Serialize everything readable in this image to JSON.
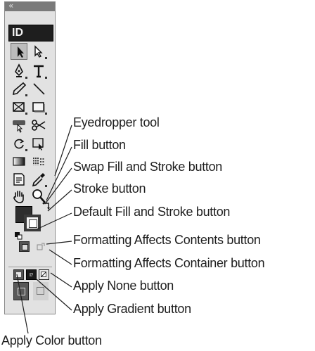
{
  "toolbox": {
    "grip_glyph": "«",
    "logo": "ID",
    "tool_names": [
      "selection",
      "direct-selection",
      "pen",
      "type",
      "pencil",
      "line",
      "rectangle-frame",
      "rectangle",
      "button",
      "scissors",
      "rotate",
      "free-transform",
      "gradient",
      "gradient-feather",
      "note",
      "eyedropper",
      "hand",
      "zoom"
    ]
  },
  "callouts": {
    "eyedropper": "Eyedropper tool",
    "fill": "Fill button",
    "swap": "Swap Fill and Stroke button",
    "stroke": "Stroke button",
    "default": "Default Fill and Stroke button",
    "fmt_contents": "Formatting Affects Contents button",
    "fmt_container": "Formatting Affects Container button",
    "apply_none": "Apply None button",
    "apply_gradient": "Apply Gradient button",
    "apply_color": "Apply Color button"
  },
  "colors": {
    "panel": "#e2e2e2",
    "text": "#1e1e1e",
    "fill_swatch": "#2e2e2e",
    "stroke_swatch": "#3a3a3a"
  }
}
